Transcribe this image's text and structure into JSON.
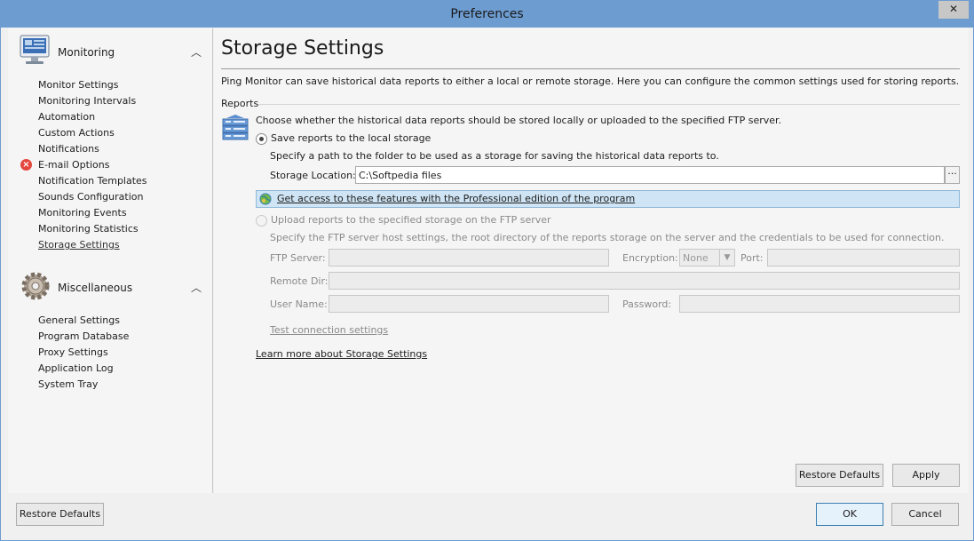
{
  "window": {
    "title": "Preferences",
    "close_glyph": "✕"
  },
  "sidebar": {
    "groups": [
      {
        "label": "Monitoring",
        "icon": "monitor-icon",
        "items": [
          {
            "label": "Monitor Settings"
          },
          {
            "label": "Monitoring Intervals"
          },
          {
            "label": "Automation"
          },
          {
            "label": "Custom Actions"
          },
          {
            "label": "Notifications"
          },
          {
            "label": "E-mail Options",
            "error_glyph": "×"
          },
          {
            "label": "Notification Templates"
          },
          {
            "label": "Sounds Configuration"
          },
          {
            "label": "Monitoring Events"
          },
          {
            "label": "Monitoring Statistics"
          },
          {
            "label": "Storage Settings",
            "selected": true
          }
        ]
      },
      {
        "label": "Miscellaneous",
        "icon": "gear-icon",
        "items": [
          {
            "label": "General Settings"
          },
          {
            "label": "Program Database"
          },
          {
            "label": "Proxy Settings"
          },
          {
            "label": "Application Log"
          },
          {
            "label": "System Tray"
          }
        ]
      }
    ],
    "chevron_glyph": "︿"
  },
  "page": {
    "title": "Storage Settings",
    "description": "Ping Monitor can save historical data reports to either a local or remote storage. Here you can configure the common settings used for storing reports.",
    "section_label": "Reports",
    "choose_text": "Choose whether the historical data reports should be stored locally or uploaded to the specified FTP server.",
    "local": {
      "option_label": "Save reports to the local storage",
      "hint": "Specify a path to the folder to be used as a storage for saving the historical data reports to.",
      "location_label": "Storage Location:",
      "location_value": "C:\\Softpedia files",
      "browse_glyph": "···"
    },
    "promo_text": "Get access to these features with the Professional edition of the program",
    "ftp": {
      "option_label": "Upload reports to the specified storage on the FTP server",
      "hint": "Specify the FTP server host settings, the root directory of the reports storage on the server and the credentials to be used for connection.",
      "server_label": "FTP Server:",
      "encryption_label": "Encryption:",
      "encryption_value": "None",
      "port_label": "Port:",
      "remote_dir_label": "Remote Dir:",
      "user_label": "User Name:",
      "password_label": "Password:",
      "test_link": "Test connection settings"
    },
    "learn_more": "Learn more about Storage Settings",
    "restore_defaults": "Restore Defaults",
    "apply": "Apply"
  },
  "footer": {
    "restore_defaults": "Restore Defaults",
    "ok": "OK",
    "cancel": "Cancel"
  }
}
